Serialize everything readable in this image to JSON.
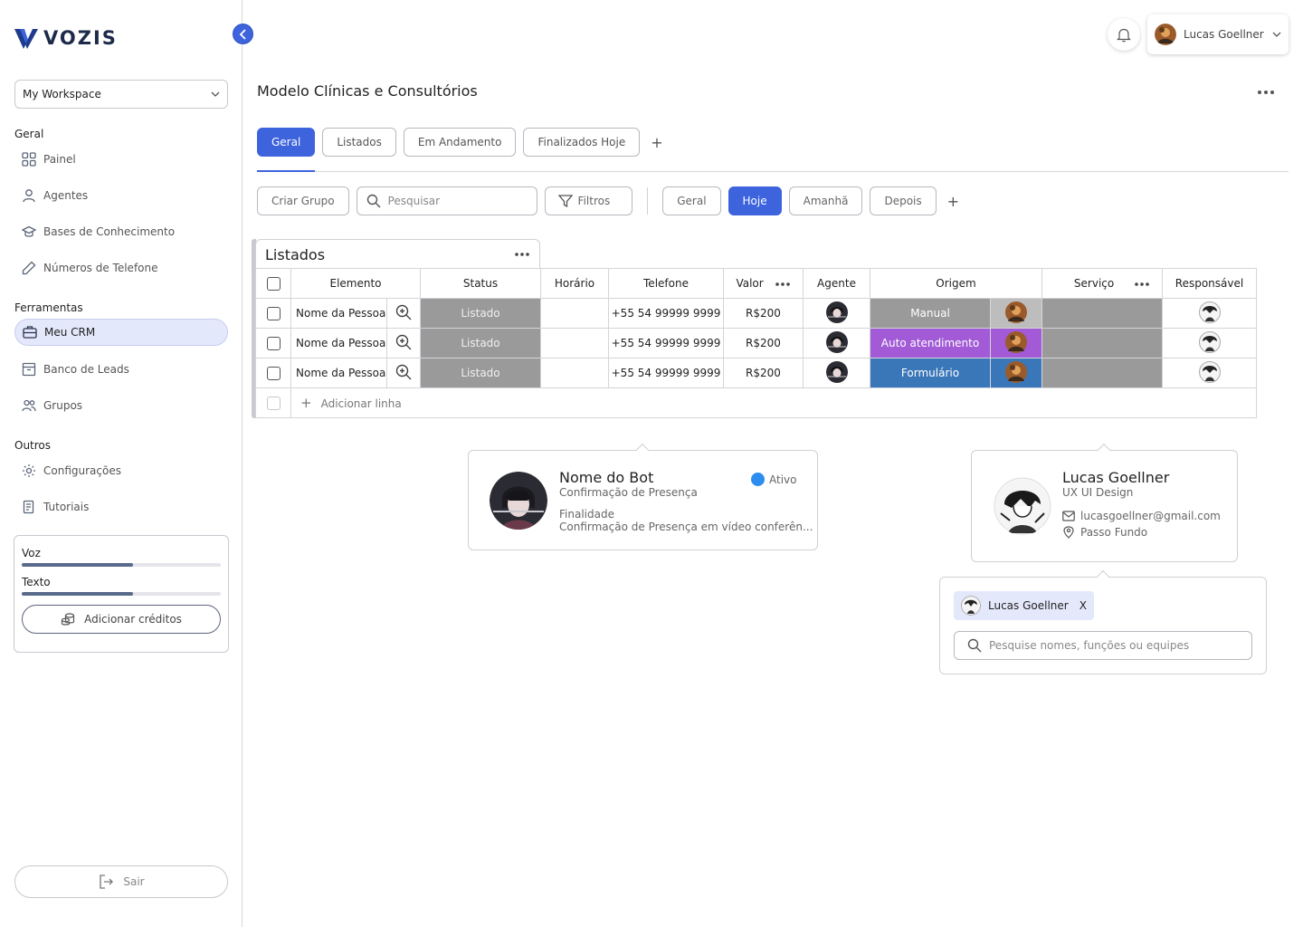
{
  "brand": {
    "name": "VOZIS",
    "accent": "#3d63dd"
  },
  "sidebar": {
    "workspace": "My Workspace",
    "sections": {
      "geral": "Geral",
      "ferramentas": "Ferramentas",
      "outros": "Outros"
    },
    "items": [
      {
        "label": "Painel",
        "icon": "grid-icon"
      },
      {
        "label": "Agentes",
        "icon": "user-icon"
      },
      {
        "label": "Bases de Conhecimento",
        "icon": "graduation-cap-icon"
      },
      {
        "label": "Números de Telefone",
        "icon": "phone-icon"
      },
      {
        "label": "Meu CRM",
        "icon": "briefcase-icon",
        "active": true
      },
      {
        "label": "Banco de Leads",
        "icon": "archive-icon"
      },
      {
        "label": "Grupos",
        "icon": "users-icon"
      },
      {
        "label": "Configurações",
        "icon": "gear-icon"
      },
      {
        "label": "Tutoriais",
        "icon": "book-icon"
      }
    ],
    "credits": {
      "voz_label": "Voz",
      "voz_level": 0.56,
      "texto_label": "Texto",
      "texto_level": 0.56,
      "add_button": "Adicionar créditos"
    },
    "logout": "Sair"
  },
  "header": {
    "user_name": "Lucas Goellner",
    "page_title": "Modelo Clínicas e Consultórios"
  },
  "tabs": [
    "Geral",
    "Listados",
    "Em Andamento",
    "Finalizados Hoje"
  ],
  "toolbar": {
    "create_group": "Criar Grupo",
    "search_placeholder": "Pesquisar",
    "filters": "Filtros",
    "periods": [
      "Geral",
      "Hoje",
      "Amanhã",
      "Depois"
    ],
    "active_period": "Hoje"
  },
  "table": {
    "group_name": "Listados",
    "columns": [
      "Elemento",
      "Status",
      "Horário",
      "Telefone",
      "Valor",
      "Agente",
      "Origem",
      "Serviço",
      "Responsável"
    ],
    "rows": [
      {
        "elemento": "Nome da Pessoa",
        "status": "Listado",
        "horario": "",
        "telefone": "+55 54 99999 9999",
        "valor": "R$200",
        "origem": "Manual",
        "origem_color": "#9a9a9a"
      },
      {
        "elemento": "Nome da Pessoa",
        "status": "Listado",
        "horario": "",
        "telefone": "+55 54 99999 9999",
        "valor": "R$200",
        "origem": "Auto atendimento",
        "origem_color": "#a25ad6"
      },
      {
        "elemento": "Nome da Pessoa",
        "status": "Listado",
        "horario": "",
        "telefone": "+55 54 99999 9999",
        "valor": "R$200",
        "origem": "Formulário",
        "origem_color": "#3a77b9"
      }
    ],
    "add_row": "Adicionar linha"
  },
  "bot_card": {
    "name": "Nome do Bot",
    "subtitle": "Confirmação de Presença",
    "status": "Ativo",
    "status_color": "#2d8cf0",
    "purpose_label": "Finalidade",
    "purpose_value": "Confirmação de Presença em vídeo conferên..."
  },
  "user_card": {
    "name": "Lucas Goellner",
    "role": "UX UI Design",
    "email": "lucasgoellner@gmail.com",
    "location": "Passo Fundo"
  },
  "assign_card": {
    "chip_name": "Lucas Goellner",
    "chip_remove": "X",
    "search_placeholder": "Pesquise nomes, funções ou equipes"
  }
}
